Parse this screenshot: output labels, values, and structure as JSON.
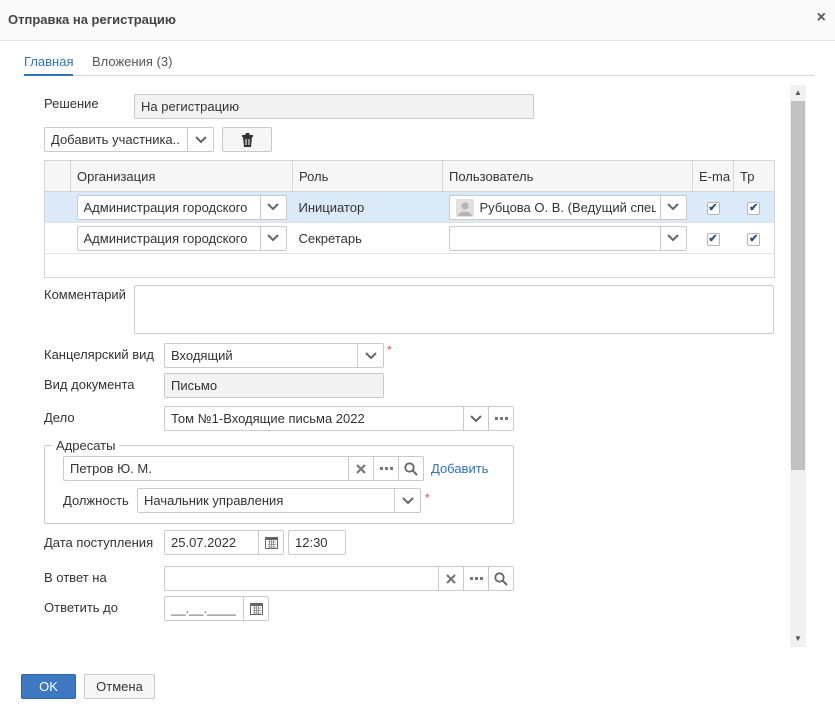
{
  "dialog": {
    "title": "Отправка на регистрацию",
    "close_glyph": "×"
  },
  "tabs": [
    {
      "label": "Главная",
      "active": true
    },
    {
      "label": "Вложения (3)",
      "active": false
    }
  ],
  "form": {
    "decision": {
      "label": "Решение",
      "value": "На регистрацию"
    },
    "add_participant": {
      "label": "Добавить участника.."
    },
    "participants": {
      "columns": [
        "Организация",
        "Роль",
        "Пользователь",
        "E-mail",
        "Тр"
      ],
      "columns_visible": [
        "Организация",
        "Роль",
        "Пользователь",
        "E-ma",
        "Тр"
      ],
      "rows": [
        {
          "organization": "Администрация городского",
          "role": "Инициатор",
          "user": "Рубцова О. В. (Ведущий специ",
          "email": true,
          "tr": true,
          "selected": true
        },
        {
          "organization": "Администрация городского",
          "role": "Секретарь",
          "user": "",
          "email": true,
          "tr": true,
          "selected": false
        }
      ]
    },
    "comment": {
      "label": "Комментарий",
      "value": ""
    },
    "office_type": {
      "label": "Канцелярский вид",
      "value": "Входящий",
      "required_mark": "*"
    },
    "doc_type": {
      "label": "Вид документа",
      "value": "Письмо"
    },
    "case": {
      "label": "Дело",
      "value": "Том №1-Входящие письма 2022"
    },
    "addressees": {
      "legend": "Адресаты",
      "value": "Петров Ю. М.",
      "add_link": "Добавить",
      "position_label": "Должность",
      "position_value": "Начальник управления",
      "required_mark": "*"
    },
    "received_date": {
      "label": "Дата поступления",
      "date": "25.07.2022",
      "time": "12:30"
    },
    "reply_to": {
      "label": "В ответ на",
      "value": ""
    },
    "reply_by": {
      "label": "Ответить до",
      "placeholder": "__.__.____"
    }
  },
  "footer": {
    "ok_label": "OK",
    "cancel_label": "Отмена"
  },
  "icons": {
    "close": "close-icon",
    "dropdown": "chevron-down-icon",
    "trash": "trash-icon",
    "clear": "clear-icon",
    "more": "ellipsis-icon",
    "search": "search-icon",
    "calendar": "calendar-icon",
    "user": "user-avatar-icon",
    "check": "checkmark-icon"
  },
  "colors": {
    "accent": "#2f74b5",
    "ok_button": "#3d78c1",
    "selected_row": "#dbeaf8",
    "required": "#d9534f"
  }
}
